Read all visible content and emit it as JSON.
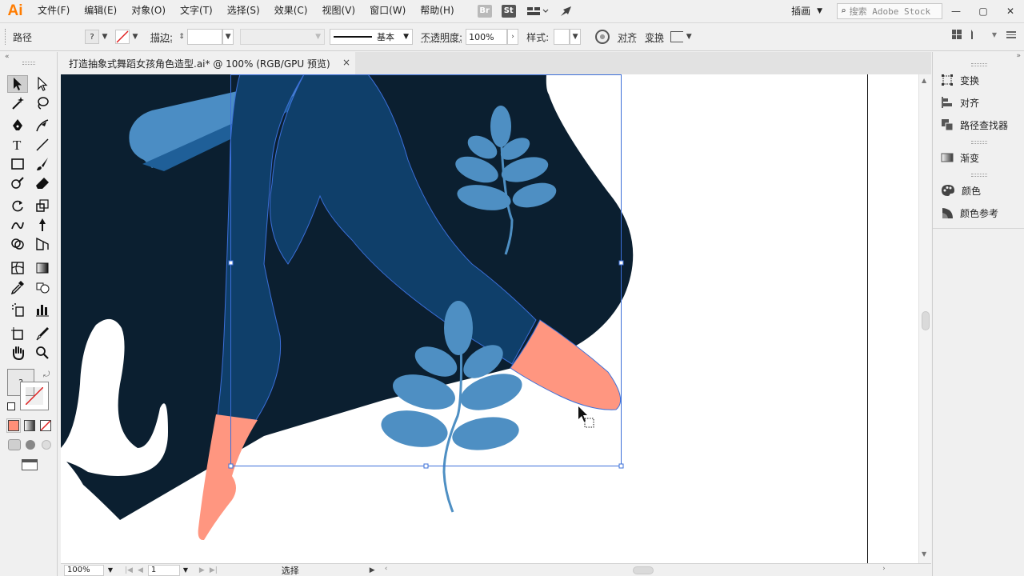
{
  "app": {
    "logo": "Ai"
  },
  "menu": {
    "items": [
      "文件(F)",
      "编辑(E)",
      "对象(O)",
      "文字(T)",
      "选择(S)",
      "效果(C)",
      "视图(V)",
      "窗口(W)",
      "帮助(H)"
    ],
    "bridge_badge": "Br",
    "stock_badge": "St"
  },
  "workspace": {
    "label": "插画"
  },
  "search": {
    "placeholder": "搜索 Adobe Stock"
  },
  "control_bar": {
    "object_type": "路径",
    "fill_value": "?",
    "stroke_label": "描边:",
    "brush_label": "基本",
    "opacity_label": "不透明度:",
    "opacity_value": "100%",
    "style_label": "样式:",
    "align_label": "对齐",
    "transform_label": "变换"
  },
  "document": {
    "tab_title": "打造抽象式舞蹈女孩角色造型.ai* @ 100% (RGB/GPU 预览)",
    "close_glyph": "×"
  },
  "toolbar": {
    "fill_stroke_glyph": "?"
  },
  "status": {
    "zoom": "100%",
    "artboard_number": "1",
    "tool_name": "选择"
  },
  "right_panel": {
    "items": [
      {
        "label": "变换",
        "icon": "transform-icon"
      },
      {
        "label": "对齐",
        "icon": "align-icon"
      },
      {
        "label": "路径查找器",
        "icon": "pathfinder-icon"
      },
      {
        "label": "渐变",
        "icon": "gradient-icon"
      },
      {
        "label": "颜色",
        "icon": "color-palette-icon"
      },
      {
        "label": "颜色参考",
        "icon": "color-guide-icon"
      }
    ]
  },
  "colors": {
    "dark_navy": "#0b1f30",
    "mid_blue": "#0f3f6a",
    "light_blue": "#4b8dc4",
    "leaf_blue": "#4e8fc3",
    "salmon": "#ff9680",
    "selection_blue": "#3b6fd9"
  }
}
